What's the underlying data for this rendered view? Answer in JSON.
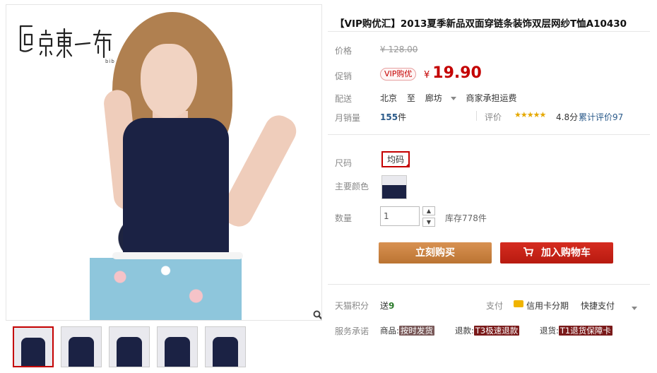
{
  "gallery": {
    "logo_text": "启京東一布",
    "zoom_icon": "magnifier-icon",
    "thumbnails": [
      1,
      2,
      3,
      4,
      5
    ]
  },
  "product": {
    "title": "【VIP购优汇】2013夏季新品双面穿链条装饰双层网纱T恤A10430",
    "price_label": "价格",
    "price_original": "¥ 128.00",
    "promo_label": "促销",
    "promo_badge": "VIP购优",
    "promo_currency": "¥",
    "promo_price": "19.90",
    "ship_label": "配送",
    "ship_from": "北京",
    "ship_to_word": "至",
    "ship_to": "廊坊",
    "ship_fee": "商家承担运费",
    "sales_label": "月销量",
    "sales_count": "155",
    "sales_unit": "件",
    "rating_label": "评价",
    "rating_stars": "★★★★★",
    "rating_score": "4.8分",
    "reviews": "累计评价97",
    "size_label": "尺码",
    "size_value": "均码",
    "color_label": "主要颜色",
    "qty_label": "数量",
    "qty_value": "1",
    "stock": "库存778件",
    "buy_label": "立刻购买",
    "cart_label": "加入购物车",
    "points_label": "天猫积分",
    "points_prefix": "送",
    "points_value": "9",
    "pay_label": "支付",
    "pay_credit": "信用卡分期",
    "pay_quick": "快捷支付",
    "service_label": "服务承诺",
    "svc_goods": "商品:",
    "svc_goods_tag": "按时发货",
    "svc_refund": "退款:",
    "svc_refund_tag": "T3极速退款",
    "svc_return": "退货:",
    "svc_return_tag": "T1退货保障卡"
  },
  "colors": {
    "accent": "#c40000",
    "buy_button": "#c8833f",
    "cart_button": "#c8241a"
  }
}
